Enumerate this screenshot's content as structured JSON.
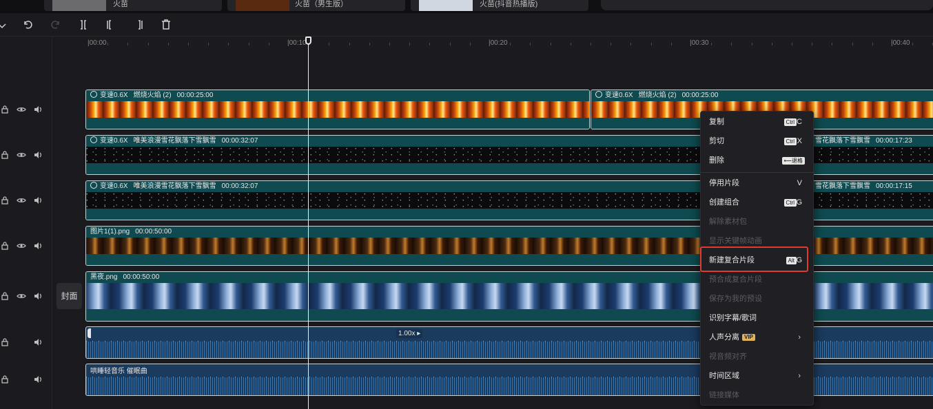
{
  "top_strip": {
    "cards": [
      {
        "label": "火苗"
      },
      {
        "label": "火苗（男生版）"
      },
      {
        "label": "火苗(抖音热播版)"
      }
    ]
  },
  "toolbar": {
    "icons": [
      "chevron-down-icon",
      "undo-icon",
      "redo-icon",
      "split-icon",
      "trim-left-icon",
      "trim-right-icon",
      "delete-icon"
    ]
  },
  "ruler": {
    "labels": [
      "|00:00",
      "|00:10",
      "|00:20",
      "|00:30",
      "|00:40"
    ]
  },
  "cover": {
    "label": "封面"
  },
  "tracks": {
    "fire": {
      "a": {
        "speed": "变速0.6X",
        "name": "燃烧火焰 (2)",
        "duration": "00:00:25:00"
      },
      "b": {
        "speed": "变速0.6X",
        "name": "燃烧火焰 (2)",
        "duration": "00:00:25:00"
      }
    },
    "snow1": {
      "a": {
        "speed": "变速0.6X",
        "name": "唯美浪漫雪花飘落下雪飘雪",
        "duration": "00:00:32:07"
      },
      "b": {
        "name": "雪花飘落下雪飘雪",
        "duration": "00:00:17:23"
      }
    },
    "snow2": {
      "a": {
        "speed": "变速0.6X",
        "name": "唯美浪漫雪花飘落下雪飘雪",
        "duration": "00:00:32:07"
      },
      "b": {
        "name": "雪花飘落下雪飘雪",
        "duration": "00:00:17:15"
      }
    },
    "image1": {
      "name": "图片1(1).png",
      "duration": "00:00:50:00"
    },
    "night": {
      "name": "黑夜.png",
      "duration": "00:00:50:00"
    },
    "audio1": {
      "speed_tag": "1.00x ▸"
    },
    "audio2": {
      "name": "哄睡轻音乐 催眠曲"
    }
  },
  "context_menu": {
    "items": [
      {
        "label": "复制",
        "key": "Ctrl",
        "letter": "C",
        "disabled": false
      },
      {
        "label": "剪切",
        "key": "Ctrl",
        "letter": "X",
        "disabled": false
      },
      {
        "label": "删除",
        "key": "⟵退格",
        "letter": "",
        "disabled": false
      },
      {
        "label": "停用片段",
        "key": "",
        "letter": "V",
        "disabled": false
      },
      {
        "label": "创建组合",
        "key": "Ctrl",
        "letter": "G",
        "disabled": false
      },
      {
        "label": "解除素材包",
        "key": "",
        "letter": "",
        "disabled": true
      },
      {
        "label": "显示关键帧动画",
        "key": "",
        "letter": "",
        "disabled": true
      },
      {
        "label": "新建复合片段",
        "key": "Alt",
        "letter": "G",
        "disabled": false
      },
      {
        "label": "预合成复合片段",
        "key": "",
        "letter": "",
        "disabled": true
      },
      {
        "label": "保存为我的预设",
        "key": "",
        "letter": "",
        "disabled": true
      },
      {
        "label": "识别字幕/歌词",
        "key": "",
        "letter": "",
        "disabled": false
      },
      {
        "label": "人声分离",
        "vip": "VIP",
        "chevron": "›",
        "disabled": false
      },
      {
        "label": "视音频对齐",
        "key": "",
        "letter": "",
        "disabled": true
      },
      {
        "label": "时间区域",
        "chevron": "›",
        "disabled": false
      },
      {
        "label": "链接媒体",
        "key": "",
        "letter": "",
        "disabled": true
      }
    ]
  },
  "colors": {
    "accent_highlight": "#e23a2e",
    "video_clip": "#0e4a4f",
    "audio_clip": "#1a3a5e"
  }
}
